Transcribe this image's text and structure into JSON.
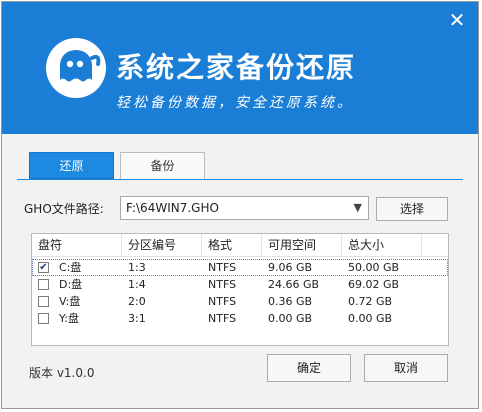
{
  "header": {
    "title": "系统之家备份还原",
    "subtitle": "轻松备份数据，安全还原系统。",
    "close_label": "✕"
  },
  "tabs": [
    {
      "label": "还原",
      "active": true
    },
    {
      "label": "备份",
      "active": false
    }
  ],
  "path": {
    "label": "GHO文件路径:",
    "value": "F:\\64WIN7.GHO",
    "browse_label": "选择"
  },
  "table": {
    "columns": [
      "盘符",
      "分区编号",
      "格式",
      "可用空间",
      "总大小"
    ],
    "rows": [
      {
        "checked": true,
        "drive": "C:盘",
        "partition": "1:3",
        "format": "NTFS",
        "free": "9.06 GB",
        "total": "50.00 GB"
      },
      {
        "checked": false,
        "drive": "D:盘",
        "partition": "1:4",
        "format": "NTFS",
        "free": "24.66 GB",
        "total": "69.02 GB"
      },
      {
        "checked": false,
        "drive": "V:盘",
        "partition": "2:0",
        "format": "NTFS",
        "free": "0.36 GB",
        "total": "0.72 GB"
      },
      {
        "checked": false,
        "drive": "Y:盘",
        "partition": "3:1",
        "format": "NTFS",
        "free": "0.00 GB",
        "total": "0.00 GB"
      }
    ]
  },
  "footer": {
    "version": "版本 v1.0.0",
    "ok_label": "确定",
    "cancel_label": "取消"
  },
  "colors": {
    "header_bg": "#1b7ed6",
    "tab_active": "#1b8ae0"
  },
  "icons": {
    "logo": "ghost-icon",
    "checkmark": "check-icon",
    "dropdown": "chevron-down-icon",
    "close": "close-icon"
  }
}
